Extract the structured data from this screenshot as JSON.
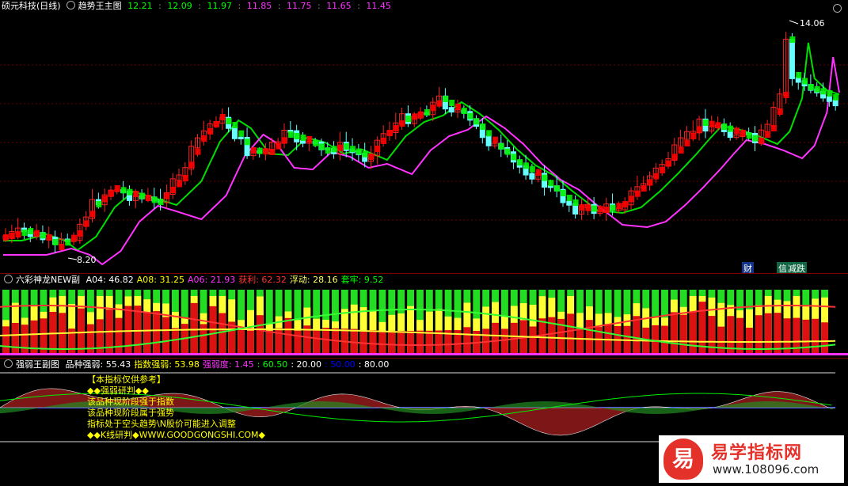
{
  "main": {
    "stock_name": "硕元科技(日线)",
    "indicator_name": "趋势王主图",
    "values": [
      "12.21",
      "12.09",
      "11.97",
      "11.85",
      "11.75",
      "11.65",
      "11.45"
    ],
    "high_label": "14.06",
    "low_label": "8.20",
    "tag_cai": "财",
    "tag_xin": "信",
    "tag_die": "减跌",
    "colors": {
      "up": "#ff2020",
      "down": "#66ffff",
      "trend_green": "#00ff00",
      "trend_magenta": "#ff33ff"
    }
  },
  "sub1": {
    "indicator_name": "六彩神龙NEW副",
    "items": [
      {
        "label": "A04:",
        "value": "46.82",
        "color": "#ffffff"
      },
      {
        "label": "A08:",
        "value": "31.25",
        "color": "#ffff00"
      },
      {
        "label": "A06:",
        "value": "21.93",
        "color": "#ff33ff"
      },
      {
        "label": "获利:",
        "value": "62.32",
        "color": "#ff3333"
      },
      {
        "label": "浮动:",
        "value": "28.16",
        "color": "#ffff66"
      },
      {
        "label": "套牢:",
        "value": "9.52",
        "color": "#00ff00"
      }
    ]
  },
  "sub2": {
    "indicator_name": "强弱王副图",
    "items": [
      {
        "label": "品种强弱:",
        "value": "55.43",
        "color": "#ffffff"
      },
      {
        "label": "指数强弱:",
        "value": "53.98",
        "color": "#ffff00"
      },
      {
        "label": "强弱度:",
        "value": "1.45",
        "color": "#ff33ff"
      }
    ],
    "levels": [
      {
        "value": "60.50",
        "color": "#00ff00"
      },
      {
        "value": "20.00",
        "color": "#ffffff"
      },
      {
        "value": "50.00",
        "color": "#0000ff"
      },
      {
        "value": "80.00",
        "color": "#ffffff"
      }
    ],
    "notes": [
      "【本指标仅供参考】",
      "◆◆强弱研判◆◆",
      "该品种现阶段强于指数",
      "该品种现阶段属于强势",
      "指标处于空头趋势\\N股价可能进入调整",
      "◆◆K线研判◆WWW.GOODGONGSHI.COM◆"
    ]
  },
  "watermark": {
    "logo_char": "易",
    "title": "易学指标网",
    "url": "www.108096.com"
  }
}
